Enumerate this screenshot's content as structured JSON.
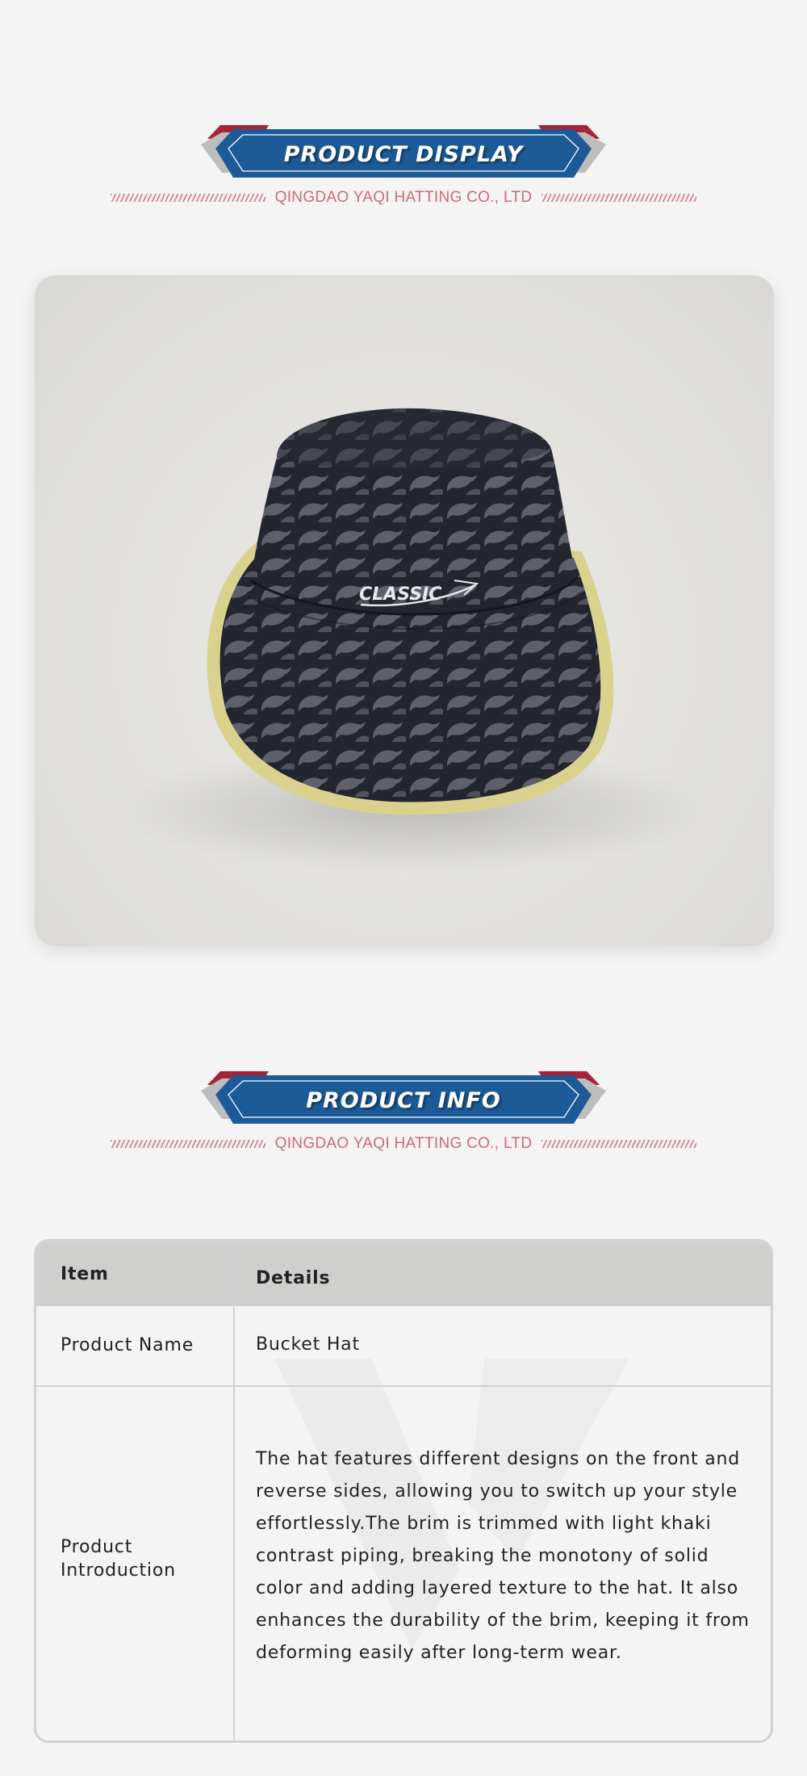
{
  "sections": {
    "display": {
      "title": "PRODUCT DISPLAY",
      "company": "QINGDAO YAQI HATTING CO., LTD"
    },
    "info": {
      "title": "PRODUCT INFO",
      "company": "QINGDAO YAQI HATTING CO., LTD"
    }
  },
  "product_image": {
    "logo_text": "CLASSIC",
    "description": "Dark navy bucket hat with grey dolphin print and light khaki piping on brim"
  },
  "table": {
    "headers": {
      "item": "Item",
      "details": "Details"
    },
    "rows": [
      {
        "item": "Product Name",
        "details": "Bucket Hat"
      },
      {
        "item": "Product Introduction",
        "details": "The hat features different designs on the front and reverse sides, allowing you to switch up your style effortlessly.The brim is trimmed with light khaki contrast piping, breaking the monotony of solid color and adding layered texture to the hat. It also enhances the durability of the brim, keeping it from deforming easily after long-term wear."
      }
    ]
  },
  "colors": {
    "banner_blue": "#1d5b98",
    "banner_red": "#a52437",
    "banner_grey": "#b9b9b9",
    "company_text": "#c9697a",
    "hat_navy": "#23252f",
    "hat_print": "#5e616c",
    "hat_piping": "#d8d28e"
  }
}
